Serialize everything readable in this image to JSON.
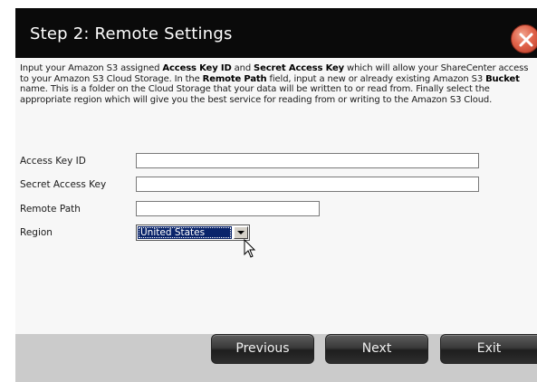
{
  "dialog": {
    "title": "Step 2: Remote Settings"
  },
  "intro": {
    "p1": "Input your Amazon S3 assigned ",
    "b1": "Access Key ID",
    "p2": " and ",
    "b2": "Secret Access Key",
    "p3": " which will allow your ShareCenter access to your Amazon S3 Cloud Storage. In the ",
    "b3": "Remote Path",
    "p4": " field, input a new or already existing Amazon S3 ",
    "b4": "Bucket",
    "p5": " name. This is a folder on the Cloud Storage that your data will be written to or read from. Finally select the appropriate region which will give you the best service for reading from or writing to the Amazon S3 Cloud."
  },
  "form": {
    "access_key_label": "Access Key ID",
    "access_key_value": "",
    "secret_key_label": "Secret Access Key",
    "secret_key_value": "",
    "remote_path_label": "Remote Path",
    "remote_path_value": "",
    "region_label": "Region",
    "region_value": "United States"
  },
  "buttons": {
    "previous": "Previous",
    "next": "Next",
    "exit": "Exit"
  },
  "colors": {
    "titlebar": "#0a0a0a",
    "close_button": "#e0634a",
    "selection": "#0a246a"
  }
}
